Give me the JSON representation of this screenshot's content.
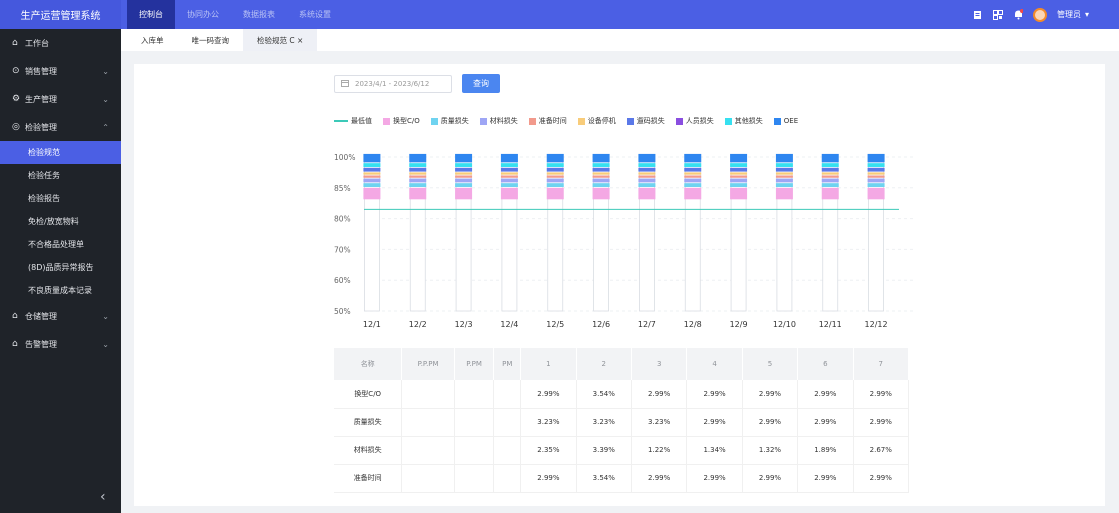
{
  "app": {
    "title": "生产运营管理系统"
  },
  "topnav": [
    {
      "label": "控制台",
      "active": true
    },
    {
      "label": "协同办公",
      "active": false
    },
    {
      "label": "数据报表",
      "active": false
    },
    {
      "label": "系统设置",
      "active": false
    }
  ],
  "topright": {
    "icons": [
      "document-icon",
      "qr-icon",
      "bell-icon"
    ],
    "username": "管理员"
  },
  "sidebar": {
    "items": [
      {
        "label": "工作台",
        "icon": "home-icon"
      },
      {
        "label": "销售管理",
        "icon": "sales-icon"
      },
      {
        "label": "生产管理",
        "icon": "production-icon"
      },
      {
        "label": "检验管理",
        "icon": "inspect-icon",
        "expanded": true,
        "children": [
          "检验规范",
          "检验任务",
          "检验报告",
          "免检/放宽物料",
          "不合格品处理单",
          "(8D)品质异常报告",
          "不良质量成本记录"
        ]
      },
      {
        "label": "仓储管理",
        "icon": "warehouse-icon"
      },
      {
        "label": "告警管理",
        "icon": "alarm-icon"
      }
    ],
    "active_child": "检验规范"
  },
  "tabs": [
    {
      "label": "入库单"
    },
    {
      "label": "唯一码查询"
    },
    {
      "label": "检验规范 C ×",
      "active": true
    }
  ],
  "filter": {
    "date_range": "2023/4/1  -  2023/6/12",
    "query_label": "查询"
  },
  "colors": {
    "最低值": "#3cc9b8",
    "换型C/O": "#f4a8e4",
    "质量损失": "#6fd3f0",
    "材料损失": "#9ea6f5",
    "准备时间": "#f29a8c",
    "设备停机": "#f8cc7a",
    "遛码损失": "#5a78e8",
    "人员损失": "#8a4ee0",
    "其他损失": "#36e0f0",
    "OEE": "#2e86f0"
  },
  "chart_data": {
    "type": "bar",
    "categories": [
      "12/1",
      "12/2",
      "12/3",
      "12/4",
      "12/5",
      "12/6",
      "12/7",
      "12/8",
      "12/9",
      "12/10",
      "12/11",
      "12/12"
    ],
    "ylabels": [
      "100%",
      "85%",
      "80%",
      "70%",
      "60%",
      "50%"
    ],
    "yticks": [
      100,
      90,
      80,
      70,
      60,
      50
    ],
    "ylim": [
      50,
      100
    ],
    "baseline": 83,
    "legend": [
      "最低值",
      "换型C/O",
      "质量损失",
      "材料损失",
      "准备时间",
      "设备停机",
      "遛码损失",
      "人员损失",
      "其他损失",
      "OEE"
    ],
    "series": [
      {
        "name": "换型C/O",
        "values": [
          4,
          4,
          4,
          4,
          4,
          4,
          4,
          4,
          4,
          4,
          4,
          4
        ]
      },
      {
        "name": "质量损失",
        "values": [
          1.5,
          1.5,
          1.5,
          1.5,
          1.5,
          1.5,
          1.5,
          1.5,
          1.5,
          1.5,
          1.5,
          1.5
        ]
      },
      {
        "name": "材料损失",
        "values": [
          1.5,
          1.5,
          1.5,
          1.5,
          1.5,
          1.5,
          1.5,
          1.5,
          1.5,
          1.5,
          1.5,
          1.5
        ]
      },
      {
        "name": "准备时间",
        "values": [
          1,
          1,
          1,
          1,
          1,
          1,
          1,
          1,
          1,
          1,
          1,
          1
        ]
      },
      {
        "name": "设备停机",
        "values": [
          1,
          1,
          1,
          1,
          1,
          1,
          1,
          1,
          1,
          1,
          1,
          1
        ]
      },
      {
        "name": "遛码损失",
        "values": [
          1.5,
          1.5,
          1.5,
          1.5,
          1.5,
          1.5,
          1.5,
          1.5,
          1.5,
          1.5,
          1.5,
          1.5
        ]
      },
      {
        "name": "其他损失",
        "values": [
          1.5,
          1.5,
          1.5,
          1.5,
          1.5,
          1.5,
          1.5,
          1.5,
          1.5,
          1.5,
          1.5,
          1.5
        ]
      },
      {
        "name": "OEE",
        "values": [
          3,
          3,
          3,
          3,
          3,
          3,
          3,
          3,
          3,
          3,
          3,
          3
        ]
      }
    ]
  },
  "table": {
    "headers": [
      "名称",
      "P.P.PM",
      "P.PM",
      "PM",
      "1",
      "2",
      "3",
      "4",
      "5",
      "6",
      "7"
    ],
    "rows": [
      [
        "换型C/O",
        "",
        "",
        "",
        "2.99%",
        "3.54%",
        "2.99%",
        "2.99%",
        "2.99%",
        "2.99%",
        "2.99%"
      ],
      [
        "质量损失",
        "",
        "",
        "",
        "3.23%",
        "3.23%",
        "3.23%",
        "2.99%",
        "2.99%",
        "2.99%",
        "2.99%"
      ],
      [
        "材料损失",
        "",
        "",
        "",
        "2.35%",
        "3.39%",
        "1.22%",
        "1.34%",
        "1.32%",
        "1.89%",
        "2.67%"
      ],
      [
        "准备时间",
        "",
        "",
        "",
        "2.99%",
        "3.54%",
        "2.99%",
        "2.99%",
        "2.99%",
        "2.99%",
        "2.99%"
      ]
    ]
  }
}
